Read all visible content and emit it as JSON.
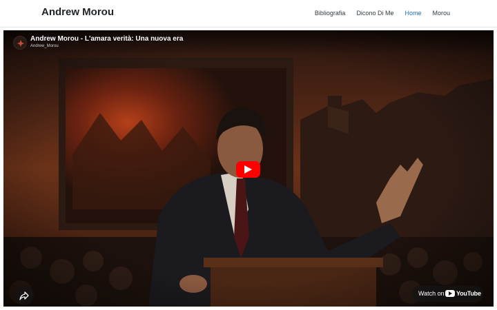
{
  "header": {
    "site_title": "Andrew Morou",
    "nav": [
      {
        "label": "Bibliografia",
        "active": false
      },
      {
        "label": "Dicono Di Me",
        "active": false
      },
      {
        "label": "Home",
        "active": true
      },
      {
        "label": "Morou",
        "active": false
      }
    ]
  },
  "video": {
    "title": "Andrew Morou - L'amara verità: Una nuova era",
    "channel": "Andrew_Morou",
    "watch_on_label": "Watch on",
    "platform_name": "YouTube",
    "icons": {
      "play": "play-icon",
      "share": "share-icon",
      "channel_avatar": "channel-avatar-icon",
      "platform_logo": "youtube-logo-icon"
    }
  },
  "colors": {
    "accent_active_nav": "#1b6fb5",
    "play_button": "#ff0000"
  }
}
